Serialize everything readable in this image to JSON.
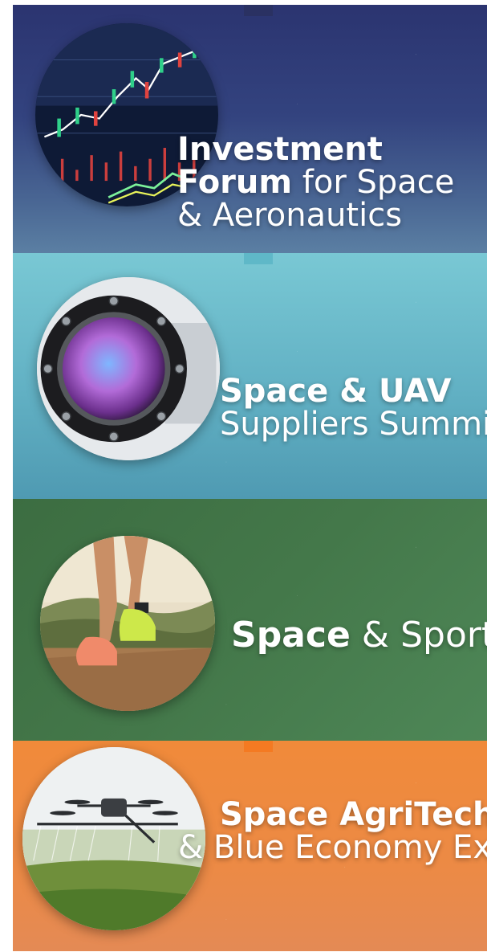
{
  "banners": [
    {
      "id": "investment-forum",
      "image_icon": "stock-chart-image",
      "title_lines": [
        [
          {
            "text": "Investment",
            "weight": "bold"
          }
        ],
        [
          {
            "text": "Forum",
            "weight": "bold"
          },
          {
            "text": " for Space",
            "weight": "light"
          }
        ],
        [
          {
            "text": "& Aeronautics",
            "weight": "light"
          }
        ]
      ],
      "background": "#2f3b78"
    },
    {
      "id": "space-uav",
      "image_icon": "optical-lens-image",
      "title_lines": [
        [
          {
            "text": "Space & UAV",
            "weight": "bold"
          }
        ],
        [
          {
            "text": "Suppliers Summit",
            "weight": "light"
          }
        ]
      ],
      "background": "#6bbdcc"
    },
    {
      "id": "space-sport",
      "image_icon": "runner-image",
      "title_lines": [
        [
          {
            "text": "Space",
            "weight": "bold"
          },
          {
            "text": " & Sport",
            "weight": "light"
          }
        ]
      ],
      "background": "#44784a"
    },
    {
      "id": "space-agritech",
      "image_icon": "drone-image",
      "title_lines": [
        [
          {
            "text": "Space AgriTech",
            "weight": "bold"
          }
        ],
        [
          {
            "text": "& Blue Economy Expo",
            "weight": "light"
          }
        ]
      ],
      "background": "#ee8a40"
    }
  ]
}
